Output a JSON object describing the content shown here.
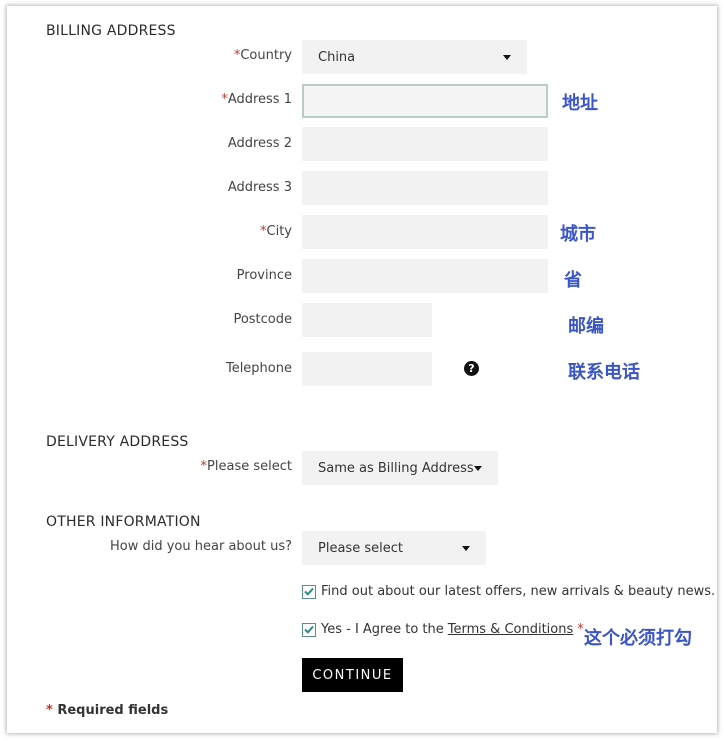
{
  "billing": {
    "title": "BILLING ADDRESS",
    "country": {
      "label": "Country",
      "value": "China"
    },
    "address1": {
      "label": "Address 1",
      "value": ""
    },
    "address2": {
      "label": "Address 2",
      "value": ""
    },
    "address3": {
      "label": "Address 3",
      "value": ""
    },
    "city": {
      "label": "City",
      "value": ""
    },
    "province": {
      "label": "Province",
      "value": ""
    },
    "postcode": {
      "label": "Postcode",
      "value": ""
    },
    "telephone": {
      "label": "Telephone",
      "value": ""
    }
  },
  "delivery": {
    "title": "DELIVERY ADDRESS",
    "select": {
      "label": "Please select",
      "value": "Same as Billing Address"
    }
  },
  "other": {
    "title": "OTHER INFORMATION",
    "hear": {
      "label": "How did you hear about us?",
      "value": "Please select"
    },
    "offers": {
      "label": "Find out about our latest offers, new arrivals & beauty news.",
      "checked": true
    },
    "terms": {
      "label": "Yes - I Agree to the",
      "link": "Terms & Conditions",
      "checked": true
    }
  },
  "required_marker": "*",
  "help_glyph": "?",
  "continue_label": "CONTINUE",
  "required_note": "Required fields",
  "annotations": {
    "address1": "地址",
    "city": "城市",
    "province": "省",
    "postcode": "邮编",
    "telephone": "联系电话",
    "terms": "这个必须打勾"
  },
  "icons": {
    "help": "question-circle-icon",
    "dropdown": "caret-down-icon",
    "checkbox": "checkmark-icon"
  },
  "colors": {
    "required": "#c0392b",
    "annotation": "#3a55c7",
    "field_bg": "#f2f2f2",
    "checkbox_border": "#5c8f89",
    "button_bg": "#000000"
  }
}
